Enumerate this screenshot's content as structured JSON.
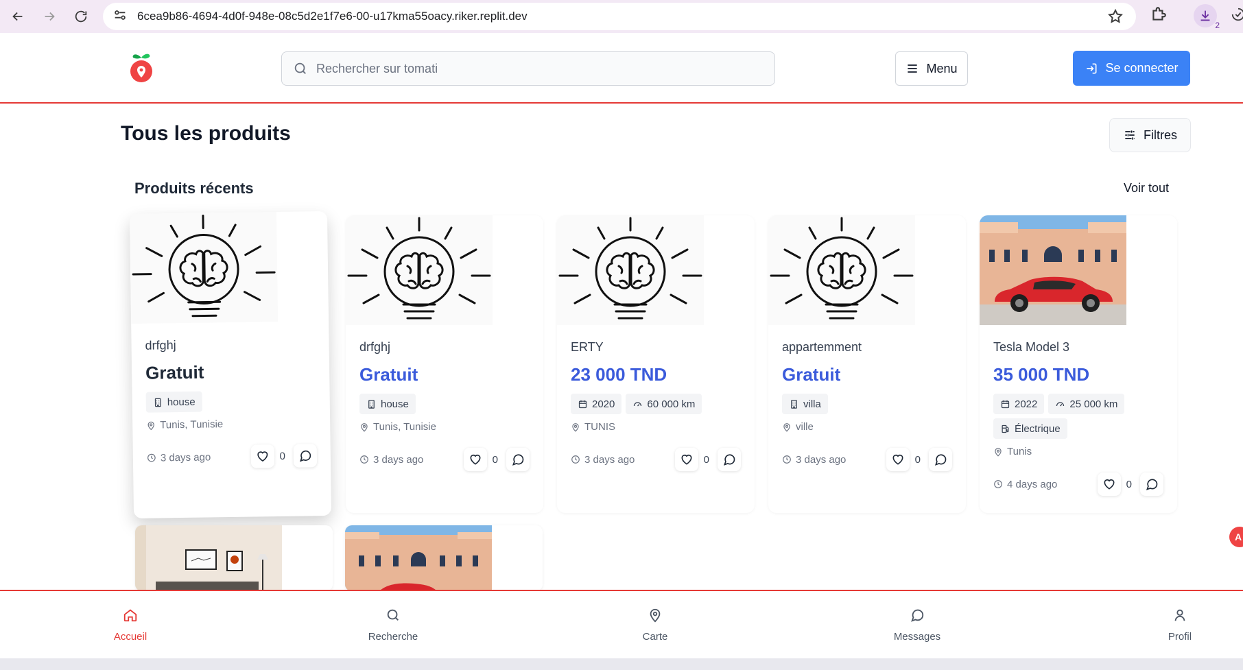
{
  "browser": {
    "url": "6cea9b86-4694-4d0f-948e-08c5d2e1f7e6-00-u17kma55oacy.riker.replit.dev",
    "download_count": "2"
  },
  "header": {
    "search_placeholder": "Rechercher sur tomati",
    "menu_label": "Menu",
    "login_label": "Se connecter",
    "brand_color": "#e53935",
    "accent_color": "#3b82f6"
  },
  "main": {
    "title": "Tous les produits",
    "filters_label": "Filtres",
    "section_title": "Produits récents",
    "see_all_label": "Voir tout"
  },
  "products": [
    {
      "name": "drfghj",
      "price": "Gratuit",
      "image": "lightbulb-brain",
      "chips": [
        {
          "icon": "building-icon",
          "label": "house"
        }
      ],
      "location": "Tunis, Tunisie",
      "time": "3 days ago",
      "likes": "0"
    },
    {
      "name": "drfghj",
      "price": "Gratuit",
      "image": "lightbulb-brain",
      "chips": [
        {
          "icon": "building-icon",
          "label": "house"
        }
      ],
      "location": "Tunis, Tunisie",
      "time": "3 days ago",
      "likes": "0"
    },
    {
      "name": "ERTY",
      "price": "23 000 TND",
      "image": "lightbulb-brain",
      "chips": [
        {
          "icon": "calendar-icon",
          "label": "2020"
        },
        {
          "icon": "gauge-icon",
          "label": "60 000 km"
        }
      ],
      "location": "TUNIS",
      "time": "3 days ago",
      "likes": "0"
    },
    {
      "name": "appartemment",
      "price": "Gratuit",
      "image": "lightbulb-brain",
      "chips": [
        {
          "icon": "building-icon",
          "label": "villa"
        }
      ],
      "location": "ville",
      "time": "3 days ago",
      "likes": "0"
    },
    {
      "name": "Tesla Model 3",
      "price": "35 000 TND",
      "image": "red-car-villa",
      "chips": [
        {
          "icon": "calendar-icon",
          "label": "2022"
        },
        {
          "icon": "gauge-icon",
          "label": "25 000 km"
        },
        {
          "icon": "fuel-icon",
          "label": "Électrique"
        }
      ],
      "location": "Tunis",
      "time": "4 days ago",
      "likes": "0"
    }
  ],
  "bottom_nav": [
    {
      "icon": "home-icon",
      "label": "Accueil",
      "active": true
    },
    {
      "icon": "search-icon",
      "label": "Recherche",
      "active": false
    },
    {
      "icon": "map-pin-icon",
      "label": "Carte",
      "active": false
    },
    {
      "icon": "message-icon",
      "label": "Messages",
      "active": false
    },
    {
      "icon": "user-icon",
      "label": "Profil",
      "active": false
    }
  ],
  "side_badge": "A"
}
